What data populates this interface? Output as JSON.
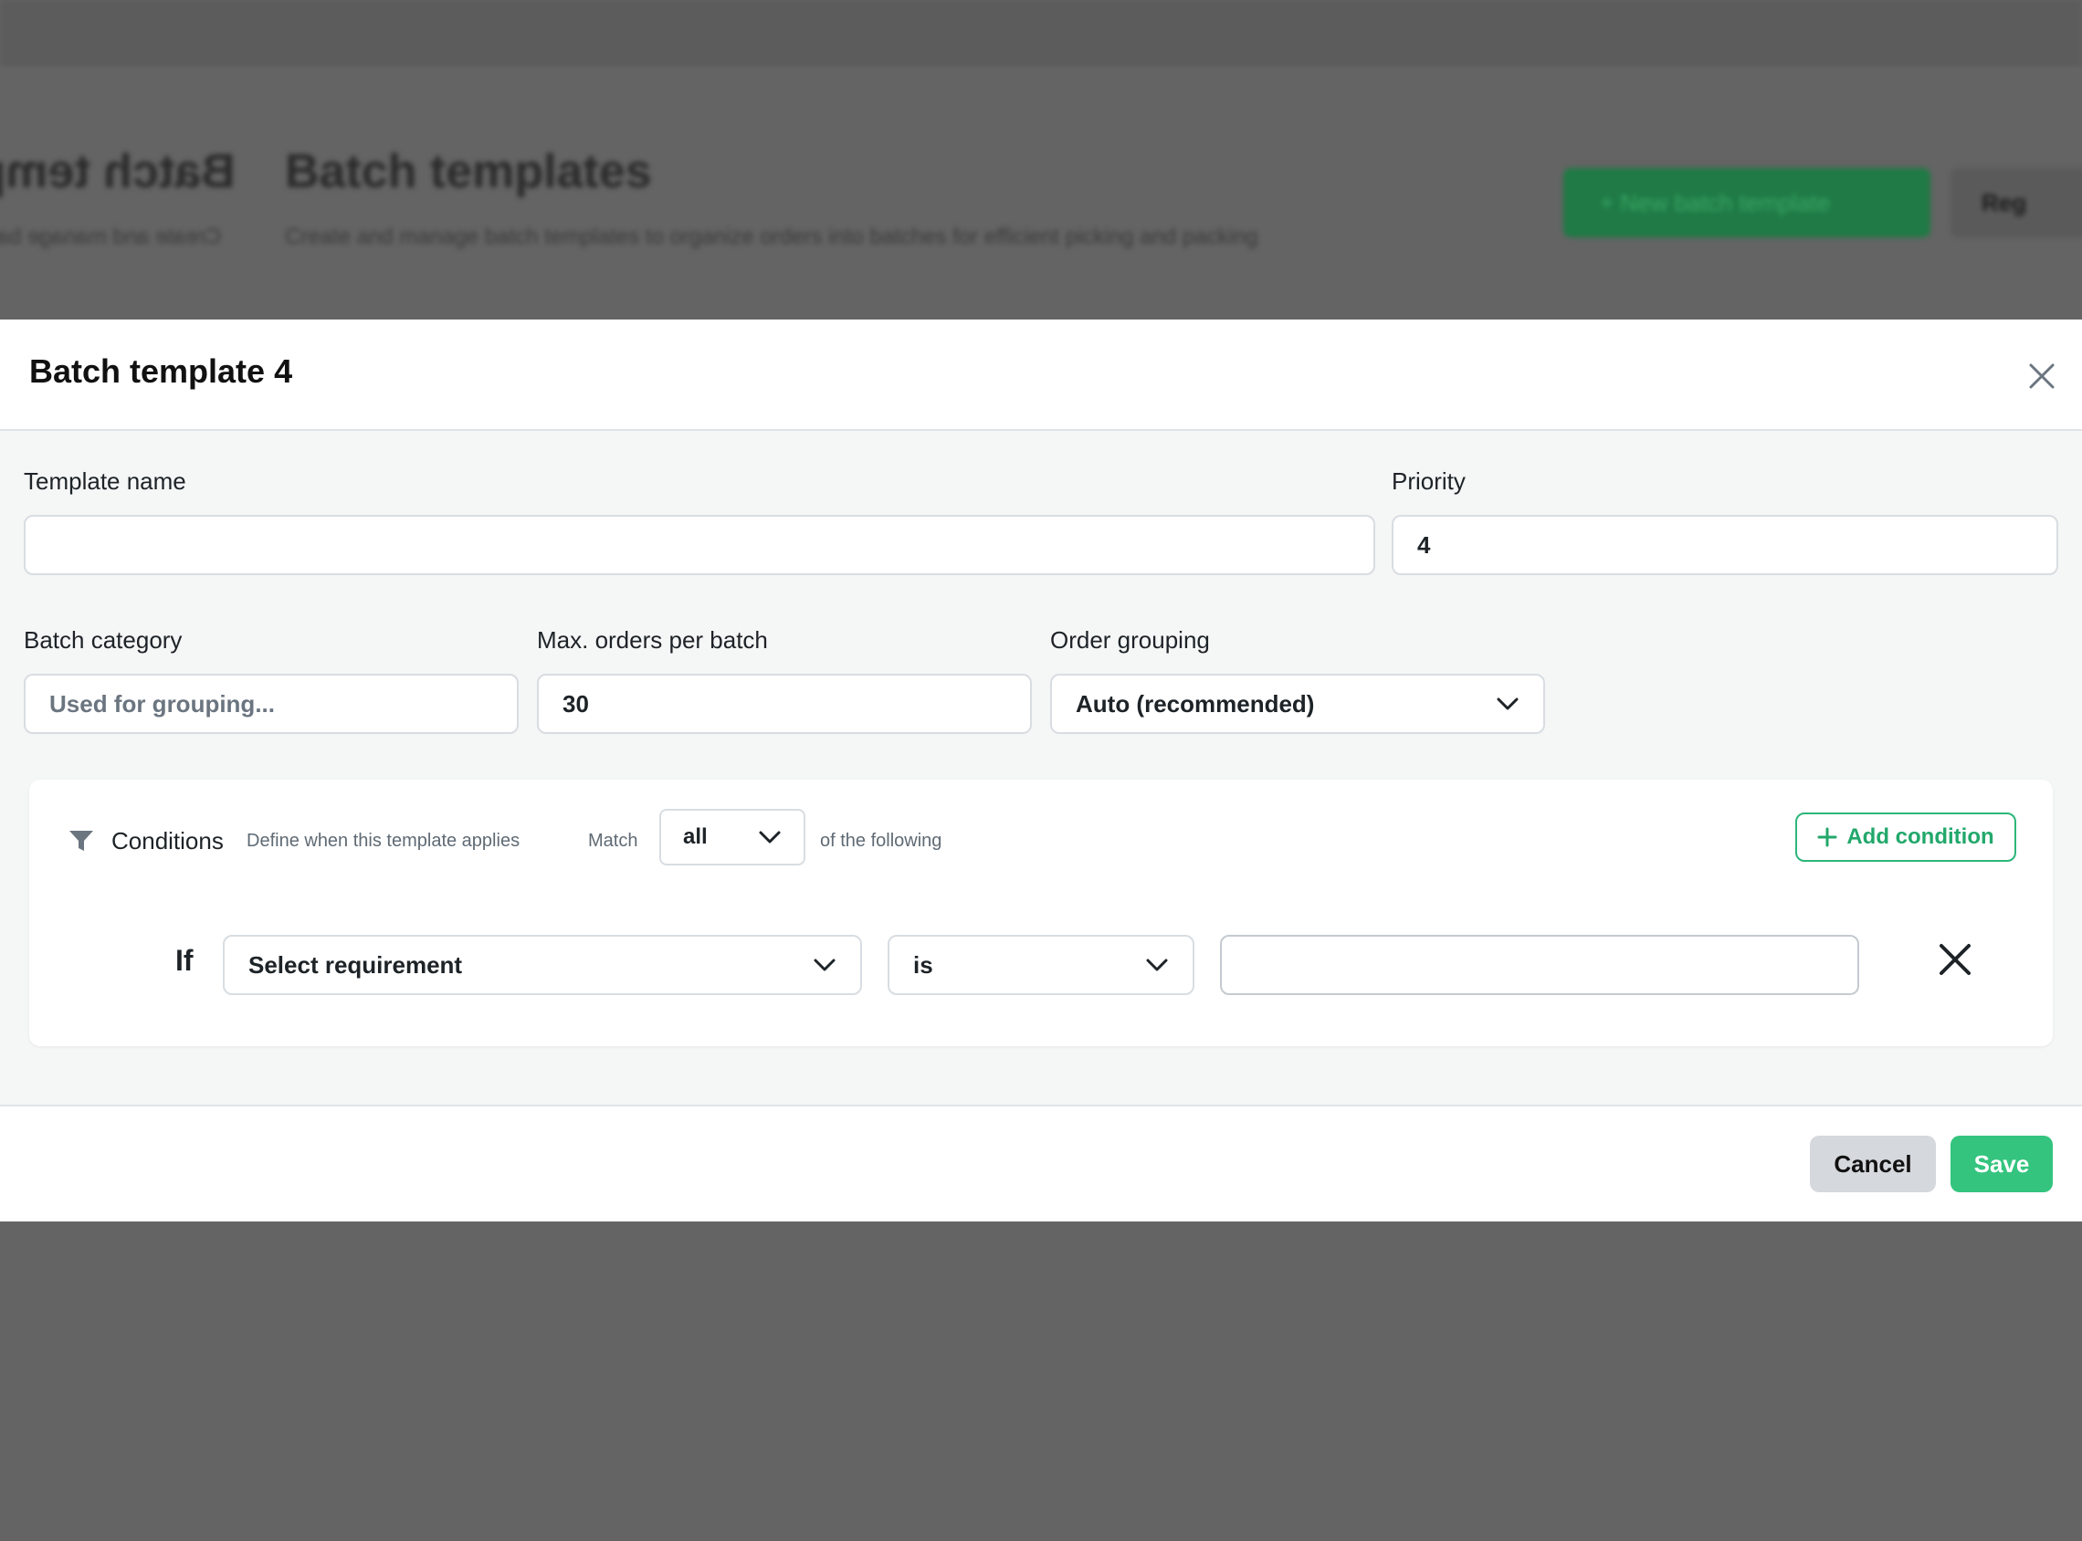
{
  "background": {
    "title_mirror": "Batch templ",
    "title": "Batch templates",
    "subtitle_mirror": "Create and manage bat",
    "subtitle": "Create and manage batch templates to organize orders into batches for efficient picking and packing",
    "primary_button": "+ New batch template",
    "secondary_button": "Reg"
  },
  "modal": {
    "title": "Batch template 4",
    "close_icon": "close-icon"
  },
  "form": {
    "template_name": {
      "label": "Template name",
      "value": ""
    },
    "priority": {
      "label": "Priority",
      "value": "4"
    },
    "batch_category": {
      "label": "Batch category",
      "placeholder": "Used for grouping...",
      "value": ""
    },
    "max_orders": {
      "label": "Max. orders per batch",
      "value": "30"
    },
    "order_grouping": {
      "label": "Order grouping",
      "value": "Auto (recommended)"
    }
  },
  "conditions": {
    "icon": "filter-icon",
    "title": "Conditions",
    "description": "Define when this template applies",
    "match_label": "Match",
    "match_value": "all",
    "following_label": "of the following",
    "add_button": "Add condition",
    "rows": [
      {
        "if_label": "If",
        "requirement": "Select requirement",
        "operator": "is",
        "value": ""
      }
    ]
  },
  "footer": {
    "cancel": "Cancel",
    "save": "Save"
  },
  "colors": {
    "overlay": "#646464",
    "accent_green": "#34c47e",
    "outline_green": "#2db67a",
    "cancel_gray": "#d5d8dc"
  }
}
